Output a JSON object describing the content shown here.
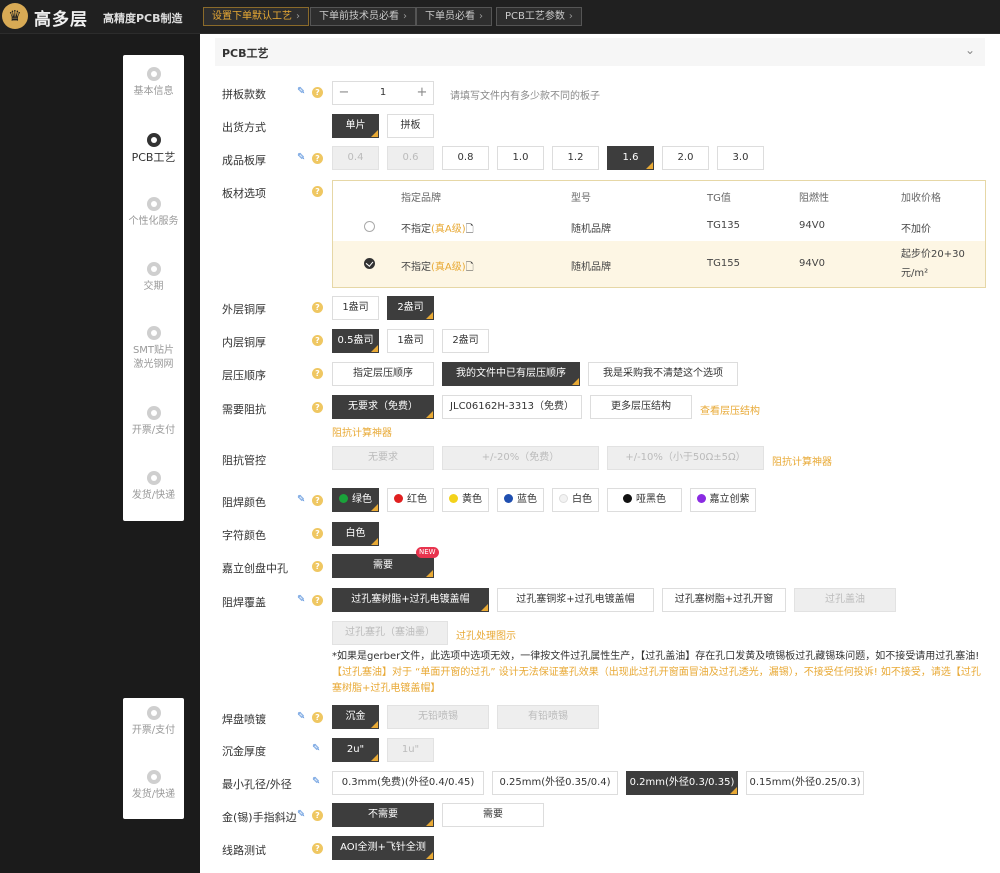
{
  "brand": {
    "logo_glyph": "♛",
    "name": "高多层",
    "tagline": "高精度PCB制造"
  },
  "top_nav": [
    {
      "label": "设置下单默认工艺",
      "active": true
    },
    {
      "label": "下单前技术员必看",
      "active": false
    },
    {
      "label": "下单员必看",
      "active": false
    },
    {
      "label": "PCB工艺参数",
      "active": false
    }
  ],
  "steps": [
    "基本信息",
    "PCB工艺",
    "个性化服务",
    "交期",
    "SMT贴片\n激光钢网",
    "开票/支付",
    "发货/快递"
  ],
  "steps2": [
    "开票/支付",
    "发货/快递"
  ],
  "section": {
    "title": "PCB工艺"
  },
  "labels": {
    "panel_count": "拼板款数",
    "ship_method": "出货方式",
    "thickness": "成品板厚",
    "material": "板材选项",
    "outer_copper": "外层铜厚",
    "inner_copper": "内层铜厚",
    "stack_order": "层压顺序",
    "impedance": "需要阻抗",
    "impedance_ctrl": "阻抗管控",
    "mask_color": "阻焊颜色",
    "silk_color": "字符颜色",
    "jlc_hole": "嘉立创盘中孔",
    "via_cover": "阻焊覆盖",
    "surface": "焊盘喷镀",
    "gold_thickness": "沉金厚度",
    "min_hole": "最小孔径/外径",
    "gold_finger": "金(锡)手指斜边",
    "test": "线路测试"
  },
  "panel_count": {
    "value": "1",
    "minus": "−",
    "plus": "+",
    "hint": "请填写文件内有多少款不同的板子"
  },
  "ship_method": [
    "单片",
    "拼板"
  ],
  "thickness": [
    "0.4",
    "0.6",
    "0.8",
    "1.0",
    "1.2",
    "1.6",
    "2.0",
    "3.0"
  ],
  "material": {
    "headers": [
      "指定品牌",
      "型号",
      "TG值",
      "阻燃性",
      "加收价格"
    ],
    "rows": [
      {
        "brand": "不指定",
        "grade": "(真A级)",
        "model": "随机品牌",
        "tg": "TG135",
        "flame": "94V0",
        "price": "不加价"
      },
      {
        "brand": "不指定",
        "grade": "(真A级)",
        "model": "随机品牌",
        "tg": "TG155",
        "flame": "94V0",
        "price": "起步价20+30元/m²"
      }
    ]
  },
  "outer_copper": [
    "1盎司",
    "2盎司"
  ],
  "inner_copper": [
    "0.5盎司",
    "1盎司",
    "2盎司"
  ],
  "stack_order": [
    "指定层压顺序",
    "我的文件中已有层压顺序",
    "我是采购我不清楚这个选项"
  ],
  "impedance": [
    "无要求（免费）",
    "JLC06162H-3313（免费）",
    "更多层压结构"
  ],
  "impedance_links": {
    "view": "查看层压结构",
    "calc": "阻抗计算神器"
  },
  "impedance_ctrl": [
    "无要求",
    "+/-20%（免费）",
    "+/-10%（小于50Ω±5Ω）"
  ],
  "mask_colors": [
    {
      "label": "绿色",
      "color": "#1aa23a"
    },
    {
      "label": "红色",
      "color": "#e02020"
    },
    {
      "label": "黄色",
      "color": "#f3d21b"
    },
    {
      "label": "蓝色",
      "color": "#1f4fb0"
    },
    {
      "label": "白色",
      "color": "#f2f2f2"
    },
    {
      "label": "哑黑色",
      "color": "#111111"
    },
    {
      "label": "嘉立创紫",
      "color": "#8a2be2"
    }
  ],
  "silk_color": [
    "白色"
  ],
  "jlc_hole": {
    "label": "需要",
    "badge": "NEW"
  },
  "via_cover": [
    "过孔塞树脂+过孔电镀盖帽",
    "过孔塞铜浆+过孔电镀盖帽",
    "过孔塞树脂+过孔开窗",
    "过孔盖油",
    "过孔塞孔（塞油墨）"
  ],
  "via_link": "过孔处理图示",
  "notice": {
    "p1": "*如果是gerber文件，此选项中选项无效，一律按文件过孔属性生产，【过孔盖油】存在孔口发黄及喷锡板过孔藏锡珠问题，如不接受请用过孔塞油!",
    "p2": "【过孔塞油】对于 “单面开窗的过孔” 设计无法保证塞孔效果（出现此过孔开窗面冒油及过孔透光，漏锡），不接受任何投诉! 如不接受，请选【过孔塞树脂+过孔电镀盖帽】"
  },
  "surface": [
    "沉金",
    "无铅喷锡",
    "有铅喷锡"
  ],
  "gold_thickness": [
    "2u\"",
    "1u\""
  ],
  "min_hole": [
    "0.3mm(免费)(外径0.4/0.45)",
    "0.25mm(外径0.35/0.4)",
    "0.2mm(外径0.3/0.35)",
    "0.15mm(外径0.25/0.3)"
  ],
  "gold_finger": [
    "不需要",
    "需要"
  ],
  "test": [
    "AOI全测+飞针全测"
  ],
  "icons": {
    "pencil": "✎",
    "help": "?",
    "chevron": "⌄",
    "file": "🗋"
  },
  "colors": {
    "accent": "#e8a935",
    "selected": "#3d3d3d",
    "edit": "#3d7fd6",
    "help": "#efc762"
  }
}
